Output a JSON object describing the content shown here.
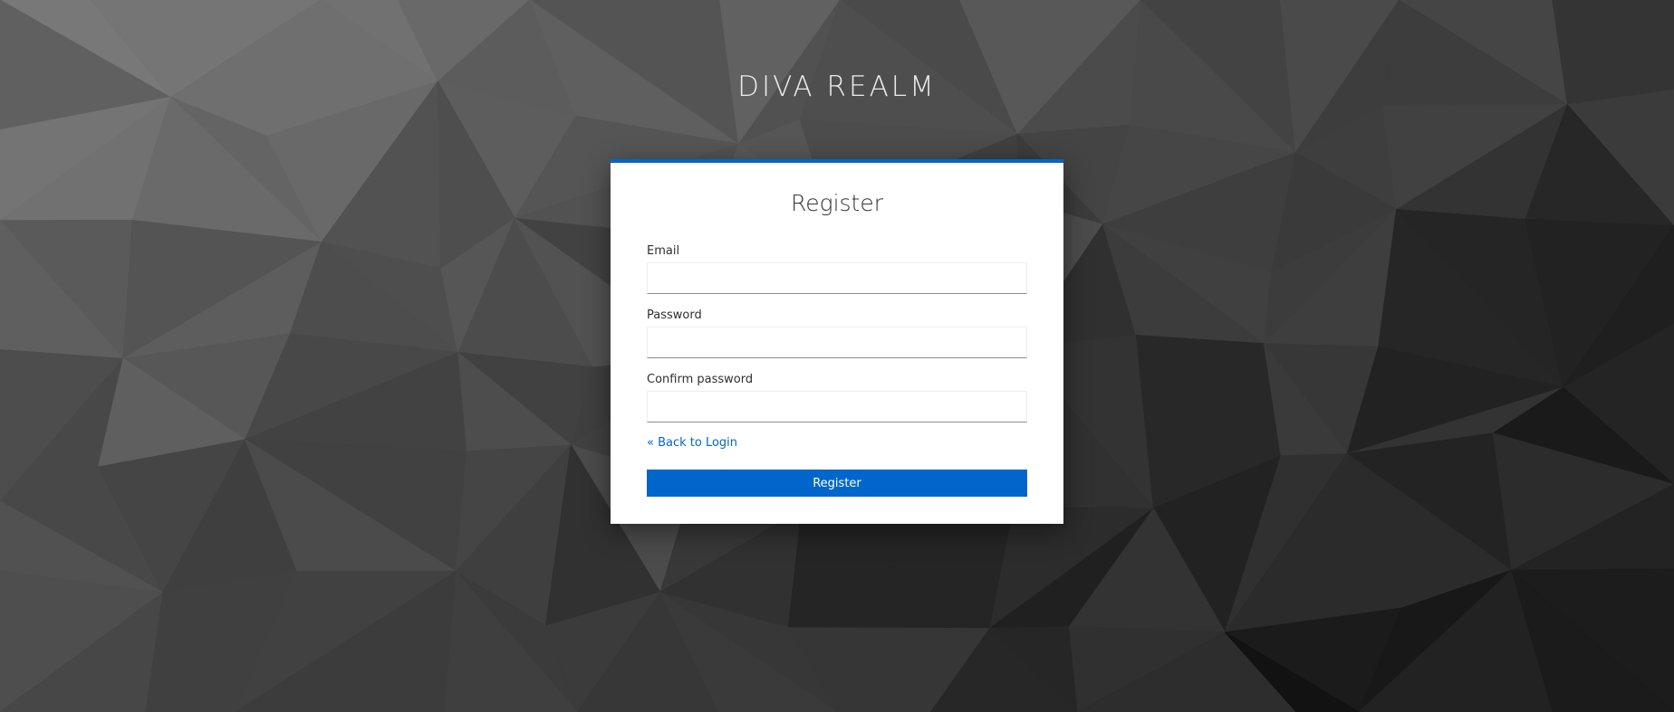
{
  "realm_title": "DIVA REALM",
  "form": {
    "title": "Register",
    "email": {
      "label": "Email",
      "value": ""
    },
    "password": {
      "label": "Password",
      "value": ""
    },
    "confirm_password": {
      "label": "Confirm password",
      "value": ""
    },
    "back_link": "« Back to Login",
    "submit_label": "Register"
  },
  "colors": {
    "accent": "#0066cc",
    "background_light": "#6c6c6c",
    "background_dark": "#0e0e0e"
  }
}
